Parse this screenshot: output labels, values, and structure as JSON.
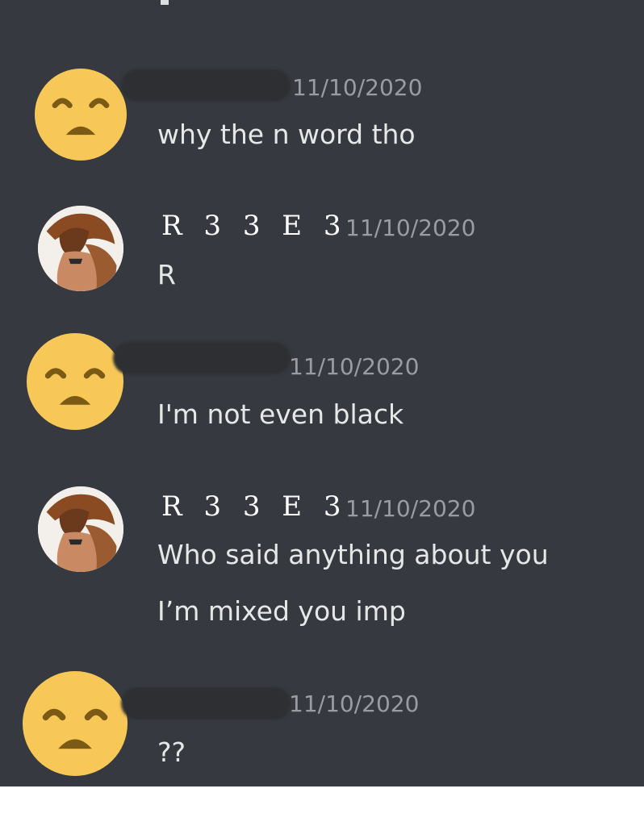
{
  "messages": [
    {
      "author": "",
      "timestamp": "11/10/2020",
      "lines": [
        "why the n word tho"
      ],
      "avatar_icon": "sad-face-emoji-icon"
    },
    {
      "author": "R 3 3 E 3",
      "timestamp": "11/10/2020",
      "lines": [
        "R"
      ],
      "avatar_icon": "user-avatar"
    },
    {
      "author": "",
      "timestamp": "11/10/2020",
      "lines": [
        "I'm not even black"
      ],
      "avatar_icon": "sad-face-emoji-icon"
    },
    {
      "author": "R 3 3 E 3",
      "timestamp": "11/10/2020",
      "lines": [
        "Who said anything about you",
        "I’m mixed you imp"
      ],
      "avatar_icon": "user-avatar"
    },
    {
      "author": "",
      "timestamp": "11/10/2020",
      "lines": [
        "??"
      ],
      "avatar_icon": "sad-face-emoji-icon"
    }
  ],
  "colors": {
    "background": "#36393f",
    "username": "#ffffff",
    "timestamp": "#9a9ca1",
    "message_text": "#e6e7e8",
    "emoji_face": "#f7c858",
    "emoji_features": "#7a5a14"
  }
}
